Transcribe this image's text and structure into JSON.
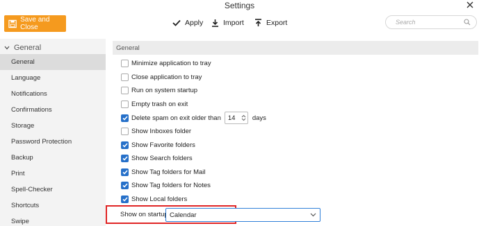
{
  "window": {
    "title": "Settings"
  },
  "toolbar": {
    "save_label": "Save and Close",
    "apply_label": "Apply",
    "import_label": "Import",
    "export_label": "Export",
    "search_placeholder": "Search"
  },
  "sidebar": {
    "group_label": "General",
    "items": [
      {
        "label": "General",
        "active": true
      },
      {
        "label": "Language"
      },
      {
        "label": "Notifications"
      },
      {
        "label": "Confirmations"
      },
      {
        "label": "Storage"
      },
      {
        "label": "Password Protection"
      },
      {
        "label": "Backup"
      },
      {
        "label": "Print"
      },
      {
        "label": "Spell-Checker"
      },
      {
        "label": "Shortcuts"
      },
      {
        "label": "Swipe"
      }
    ]
  },
  "main": {
    "section_title": "General",
    "options": [
      {
        "label": "Minimize application to tray",
        "checked": false
      },
      {
        "label": "Close application to tray",
        "checked": false
      },
      {
        "label": "Run on system startup",
        "checked": false
      },
      {
        "label": "Empty trash on exit",
        "checked": false
      },
      {
        "label": "Delete spam on exit older than",
        "checked": true,
        "spin_value": "14",
        "suffix": "days"
      },
      {
        "label": "Show Inboxes folder",
        "checked": false
      },
      {
        "label": "Show Favorite folders",
        "checked": true
      },
      {
        "label": "Show Search folders",
        "checked": true
      },
      {
        "label": "Show Tag folders for Mail",
        "checked": true
      },
      {
        "label": "Show Tag folders for Notes",
        "checked": true
      },
      {
        "label": "Show Local folders",
        "checked": true
      }
    ],
    "startup": {
      "label": "Show on startup:",
      "value": "Calendar"
    }
  },
  "colors": {
    "accent_orange": "#f59a1e",
    "checkbox_blue": "#2670c9",
    "highlight_red": "#e02424"
  }
}
